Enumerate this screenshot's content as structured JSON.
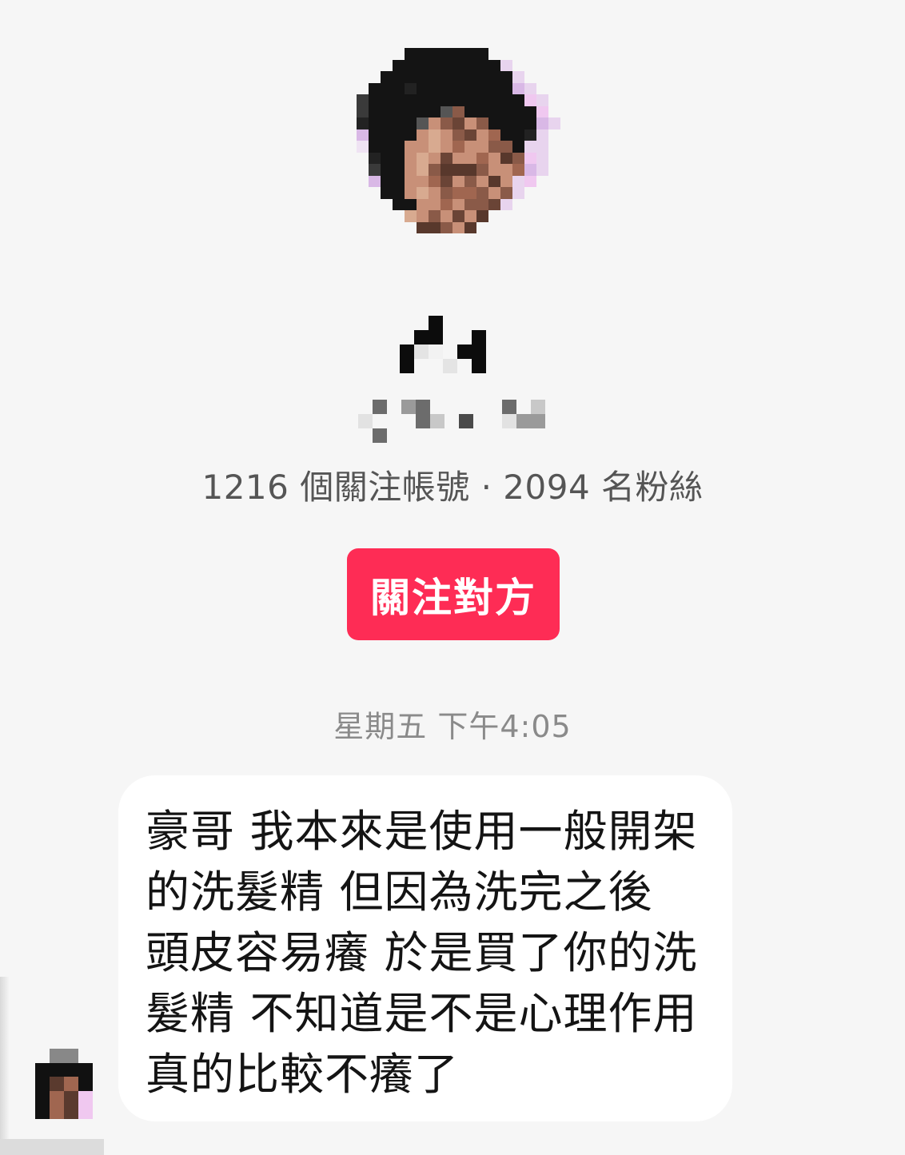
{
  "profile": {
    "stats_text": "1216 個關注帳號 · 2094 名粉絲",
    "follow_button_label": "關注對方"
  },
  "chat": {
    "timestamp": "星期五 下午4:05",
    "messages": [
      {
        "text": "豪哥 我本來是使用一般開架的洗髮精  但因為洗完之後 頭皮容易癢 於是買了你的洗髮精  不知道是不是心理作用 真的比較不癢了"
      }
    ]
  },
  "colors": {
    "accent": "#fe2c55",
    "background": "#f6f6f6",
    "bubble": "#ffffff",
    "stats_text": "#555555",
    "timestamp_text": "#8a8a8a"
  }
}
